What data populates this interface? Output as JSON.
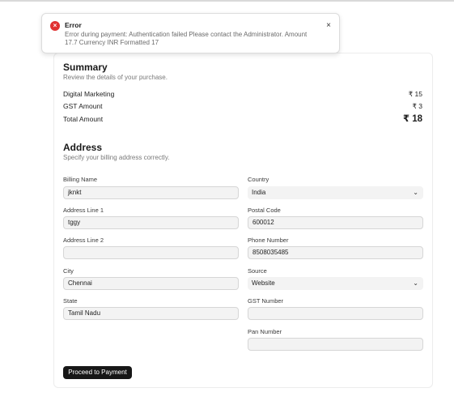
{
  "toast": {
    "title": "Error",
    "message": "Error during payment: Authentication failed Please contact the Administrator. Amount 17.7 Currency INR Formatted 17",
    "close": "×"
  },
  "summary": {
    "title": "Summary",
    "subtitle": "Review the details of your purchase.",
    "rows": [
      {
        "label": "Digital Marketing",
        "value": "₹ 15"
      },
      {
        "label": "GST Amount",
        "value": "₹ 3"
      },
      {
        "label": "Total Amount",
        "value": "₹ 18"
      }
    ]
  },
  "address": {
    "title": "Address",
    "subtitle": "Specify your billing address correctly.",
    "billing_name": {
      "label": "Billing Name",
      "value": "jknkt"
    },
    "address_line_1": {
      "label": "Address Line 1",
      "value": "tggy"
    },
    "address_line_2": {
      "label": "Address Line 2",
      "value": ""
    },
    "city": {
      "label": "City",
      "value": "Chennai"
    },
    "state": {
      "label": "State",
      "value": "Tamil Nadu"
    },
    "country": {
      "label": "Country",
      "value": "India"
    },
    "postal_code": {
      "label": "Postal Code",
      "value": "600012"
    },
    "phone_number": {
      "label": "Phone Number",
      "value": "8508035485"
    },
    "source": {
      "label": "Source",
      "value": "Website"
    },
    "gst_number": {
      "label": "GST Number",
      "value": ""
    },
    "pan_number": {
      "label": "Pan Number",
      "value": ""
    }
  },
  "proceed_button": "Proceed to Payment"
}
